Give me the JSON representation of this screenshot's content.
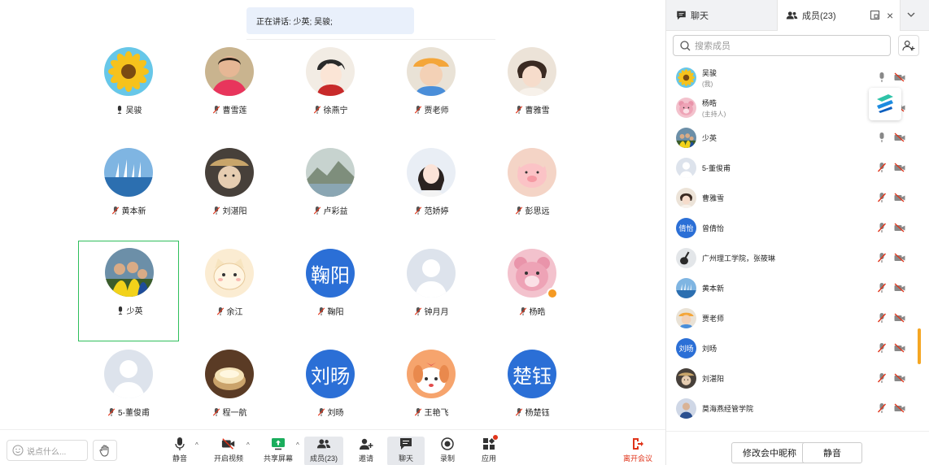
{
  "speaking": {
    "text": "正在讲话: 少英; 吴骏;"
  },
  "grid": [
    {
      "name": "吴骏",
      "mic": "on",
      "avatar": "sunflower"
    },
    {
      "name": "曹雪莲",
      "mic": "off",
      "avatar": "photo-woman"
    },
    {
      "name": "徐燕宁",
      "mic": "off",
      "avatar": "anime-boy"
    },
    {
      "name": "贾老师",
      "mic": "off",
      "avatar": "child-hat"
    },
    {
      "name": "曹雅雪",
      "mic": "off",
      "avatar": "baby"
    },
    {
      "name": "黄本新",
      "mic": "off",
      "avatar": "sailboats"
    },
    {
      "name": "刘湛阳",
      "mic": "off",
      "avatar": "bear-hat"
    },
    {
      "name": "卢彩益",
      "mic": "off",
      "avatar": "landscape"
    },
    {
      "name": "范娇婷",
      "mic": "off",
      "avatar": "girl"
    },
    {
      "name": "彭思远",
      "mic": "off",
      "avatar": "pig"
    },
    {
      "name": "少英",
      "mic": "on",
      "avatar": "family",
      "active": true
    },
    {
      "name": "余江",
      "mic": "off",
      "avatar": "cat-cartoon"
    },
    {
      "name": "鞠阳",
      "mic": "off",
      "avatar_text": "鞠阳"
    },
    {
      "name": "钟月月",
      "mic": "off",
      "avatar": "placeholder"
    },
    {
      "name": "杨晧",
      "mic": "off",
      "avatar": "pink-bear",
      "host": true
    },
    {
      "name": "5-董俊甫",
      "mic": "off",
      "avatar": "placeholder"
    },
    {
      "name": "程一航",
      "mic": "off",
      "avatar": "cake"
    },
    {
      "name": "刘旸",
      "mic": "off",
      "avatar_text": "刘旸"
    },
    {
      "name": "王艳飞",
      "mic": "off",
      "avatar": "dog"
    },
    {
      "name": "杨楚钰",
      "mic": "off",
      "avatar_text": "楚钰"
    }
  ],
  "toolbar": {
    "say_placeholder": "说点什么...",
    "mute": "静音",
    "video": "开启视频",
    "share": "共享屏幕",
    "members": "成员(23)",
    "invite": "邀请",
    "chat": "聊天",
    "record": "录制",
    "apps": "应用",
    "leave": "离开会议"
  },
  "side": {
    "tab_chat": "聊天",
    "tab_members": "成员(23)",
    "search_placeholder": "搜索成员",
    "members": [
      {
        "name": "吴骏",
        "sub": "(我)",
        "mic": "on",
        "avatar": "sunflower"
      },
      {
        "name": "杨晧",
        "sub": "(主持人)",
        "mic": "off",
        "avatar": "pink-bear"
      },
      {
        "name": "少英",
        "mic": "on",
        "avatar": "family"
      },
      {
        "name": "5-董俊甫",
        "mic": "off",
        "avatar": "placeholder"
      },
      {
        "name": "曹雅雪",
        "mic": "off",
        "avatar": "baby"
      },
      {
        "name": "曾倩怡",
        "mic": "off",
        "avatar_text": "倩怡"
      },
      {
        "name": "广州理工学院，张筱琳",
        "mic": "off",
        "avatar": "guitar"
      },
      {
        "name": "黄本新",
        "mic": "off",
        "avatar": "sailboats"
      },
      {
        "name": "贾老师",
        "mic": "off",
        "avatar": "child-hat"
      },
      {
        "name": "刘旸",
        "mic": "off",
        "avatar_text": "刘旸"
      },
      {
        "name": "刘湛阳",
        "mic": "off",
        "avatar": "bear-hat"
      },
      {
        "name": "莫海燕经管学院",
        "mic": "off",
        "avatar": "person-blue"
      }
    ],
    "btn_rename": "修改会中昵称",
    "btn_mute": "静音"
  }
}
